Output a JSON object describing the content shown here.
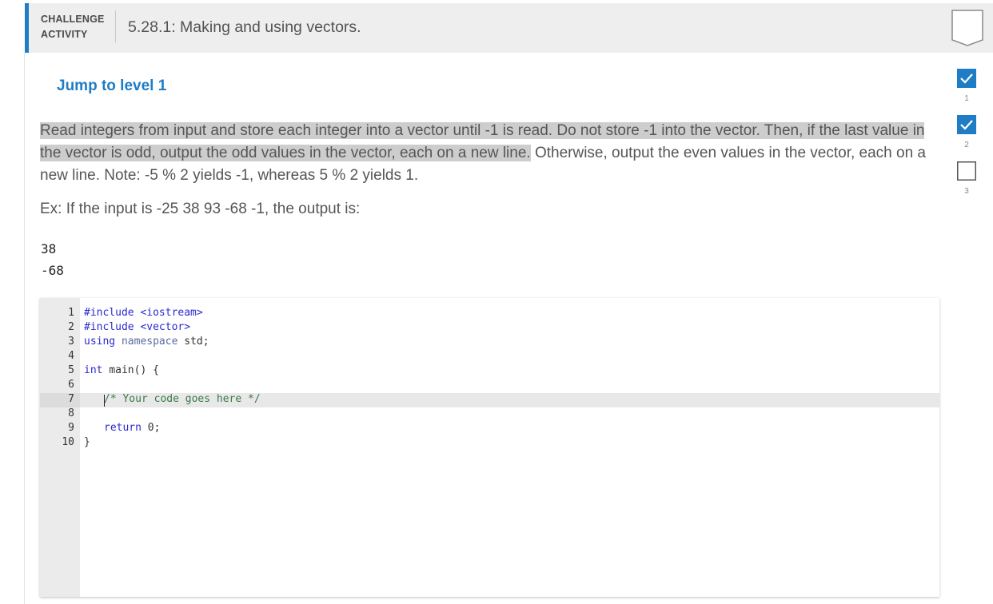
{
  "header": {
    "label_line1": "CHALLENGE",
    "label_line2": "ACTIVITY",
    "title": "5.28.1: Making and using vectors."
  },
  "jump_link": "Jump to level 1",
  "prompt": {
    "highlighted": "Read integers from input and store each integer into a vector until -1 is read. Do not store -1 into the vector. Then, if the last value in the vector is odd, output the odd values in the vector, each on a new line.",
    "rest": " Otherwise, output the even values in the vector, each on a new line. Note: -5 % 2 yields -1, whereas 5 % 2 yields 1."
  },
  "example": "Ex: If the input is -25 38 93 -68 -1, the output is:",
  "output_lines": [
    "38",
    "-68"
  ],
  "editor": {
    "line_numbers": [
      "1",
      "2",
      "3",
      "4",
      "5",
      "6",
      "7",
      "8",
      "9",
      "10"
    ],
    "line1": "#include <iostream>",
    "line2": "#include <vector>",
    "line3_kw1": "using",
    "line3_kw2": "namespace",
    "line3_rest": "std;",
    "line5_kw": "int",
    "line5_rest": "main() {",
    "line7": "/* Your code goes here */",
    "line9_kw": "return",
    "line9_rest": "0;",
    "line10": "}",
    "active_line": "7"
  },
  "levels": [
    {
      "number": "1",
      "status": "completed"
    },
    {
      "number": "2",
      "status": "completed"
    },
    {
      "number": "3",
      "status": "incomplete"
    }
  ],
  "colors": {
    "accent": "#1f7dc6",
    "header_bg": "#eeeeee",
    "highlight": "#cdcdcd"
  }
}
